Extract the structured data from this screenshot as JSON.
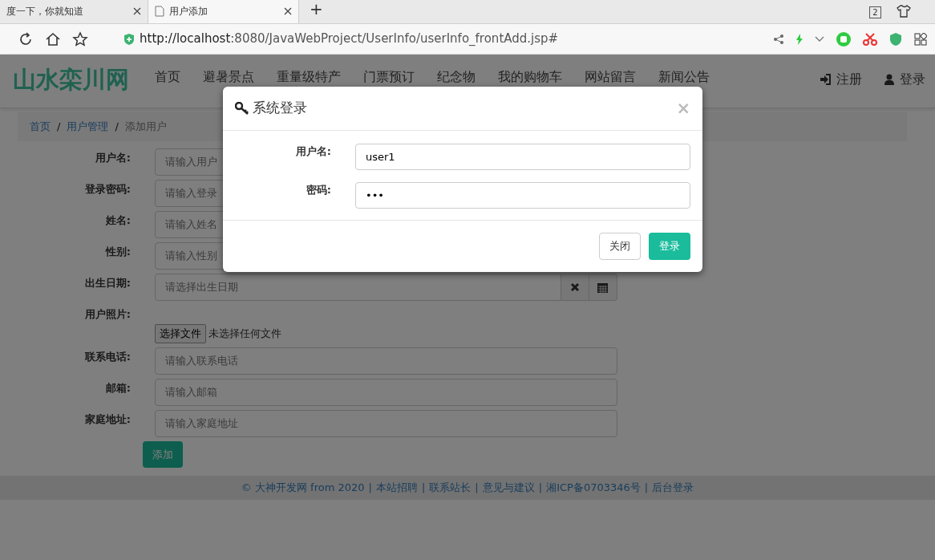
{
  "browser": {
    "tabs": [
      {
        "title": "度一下，你就知道",
        "selected": false
      },
      {
        "title": "用户添加",
        "selected": true
      }
    ],
    "new_tab": "+",
    "tab_count": "2",
    "url_host": "http://localhost",
    "url_rest": ":8080/JavaWebProject/UserInfo/userInfo_frontAdd.jsp#"
  },
  "navbar": {
    "brand": "山水栾川网",
    "items": [
      "首页",
      "避暑景点",
      "重量级特产",
      "门票预订",
      "纪念物",
      "我的购物车",
      "网站留言",
      "新闻公告"
    ],
    "actions": [
      {
        "label": "注册",
        "kind": "register"
      },
      {
        "label": "登录",
        "kind": "login"
      }
    ]
  },
  "breadcrumb": [
    {
      "label": "首页",
      "link": true
    },
    {
      "label": "用户管理",
      "link": true
    },
    {
      "label": "添加用户",
      "link": false
    }
  ],
  "breadcrumb_separator": "/",
  "form": {
    "fields": [
      {
        "label": "用户名:",
        "kind": "text",
        "placeholder": "请输入用户"
      },
      {
        "label": "登录密码:",
        "kind": "text",
        "placeholder": "请输入登录"
      },
      {
        "label": "姓名:",
        "kind": "text",
        "placeholder": "请输入姓名"
      },
      {
        "label": "性别:",
        "kind": "text",
        "placeholder": "请输入性别"
      },
      {
        "label": "出生日期:",
        "kind": "date",
        "placeholder": "请选择出生日期"
      },
      {
        "label": "用户照片:",
        "kind": "file",
        "button": "选择文件",
        "status": "未选择任何文件"
      },
      {
        "label": "联系电话:",
        "kind": "text",
        "placeholder": "请输入联系电话"
      },
      {
        "label": "邮箱:",
        "kind": "text",
        "placeholder": "请输入邮箱"
      },
      {
        "label": "家庭地址:",
        "kind": "text",
        "placeholder": "请输入家庭地址"
      }
    ],
    "submit": "添加"
  },
  "footer": {
    "separator": "|",
    "items": [
      "© 大神开发网 from 2020",
      "本站招聘",
      "联系站长",
      "意见与建议",
      "湘ICP备0703346号",
      "后台登录"
    ]
  },
  "modal": {
    "title": "系统登录",
    "close": "×",
    "fields": [
      {
        "label": "用户名:",
        "value": "user1"
      },
      {
        "label": "密码:",
        "value": "•••"
      }
    ],
    "buttons": [
      {
        "label": "关闭",
        "kind": "secondary"
      },
      {
        "label": "登录",
        "kind": "primary"
      }
    ]
  }
}
